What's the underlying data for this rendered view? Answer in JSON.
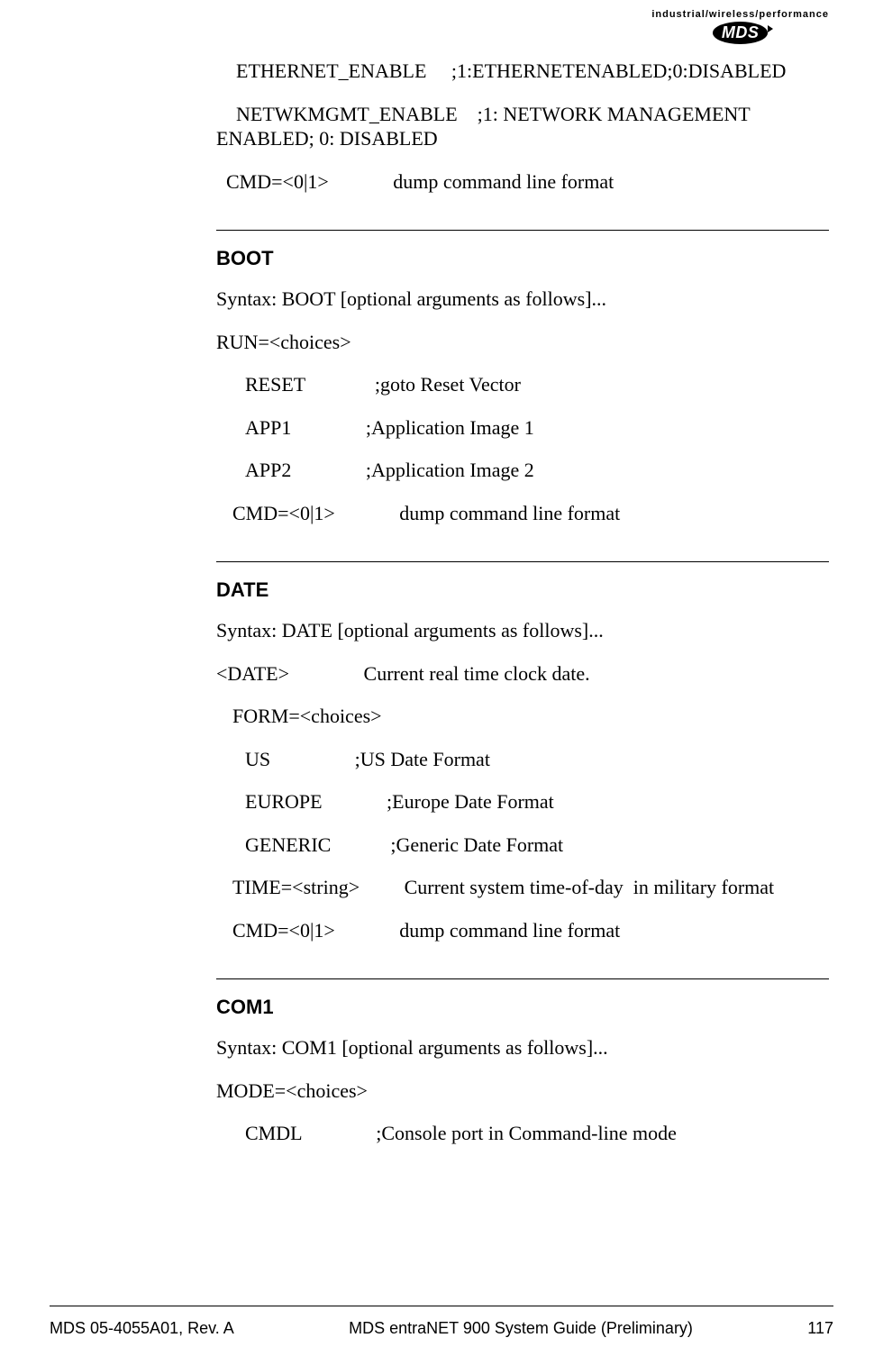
{
  "logo": {
    "tagline": "industrial/wireless/performance",
    "mark": "MDS"
  },
  "intro": {
    "line1": "    ETHERNET_ENABLE     ;1:ETHERNETENABLED;0:DISABLED",
    "line2": "    NETWKMGMT_ENABLE    ;1: NETWORK MANAGEMENT ENABLED; 0: DISABLED",
    "line3": "  CMD=<0|1>             dump command line format"
  },
  "boot": {
    "heading": "BOOT",
    "syntax": "Syntax: BOOT [optional arguments as follows]...",
    "run": "RUN=<choices>",
    "opt1": "RESET              ;goto Reset Vector",
    "opt2": "APP1               ;Application Image 1",
    "opt3": "APP2               ;Application Image 2",
    "cmd": "CMD=<0|1>             dump command line format"
  },
  "date": {
    "heading": "DATE",
    "syntax": "Syntax: DATE [optional arguments as follows]...",
    "dateline": "<DATE>               Current real time clock date.",
    "form": "FORM=<choices>",
    "opt1": "US                 ;US Date Format",
    "opt2": "EUROPE             ;Europe Date Format",
    "opt3": "GENERIC            ;Generic Date Format",
    "time": "TIME=<string>         Current system time-of-day  in military format",
    "cmd": "CMD=<0|1>             dump command line format"
  },
  "com1": {
    "heading": "COM1",
    "syntax": "Syntax: COM1 [optional arguments as follows]...",
    "mode": "MODE=<choices>",
    "opt1": "CMDL               ;Console port in Command-line mode"
  },
  "footer": {
    "left": "MDS 05-4055A01, Rev. A",
    "center": "MDS entraNET 900 System Guide (Preliminary)",
    "right": "117"
  }
}
